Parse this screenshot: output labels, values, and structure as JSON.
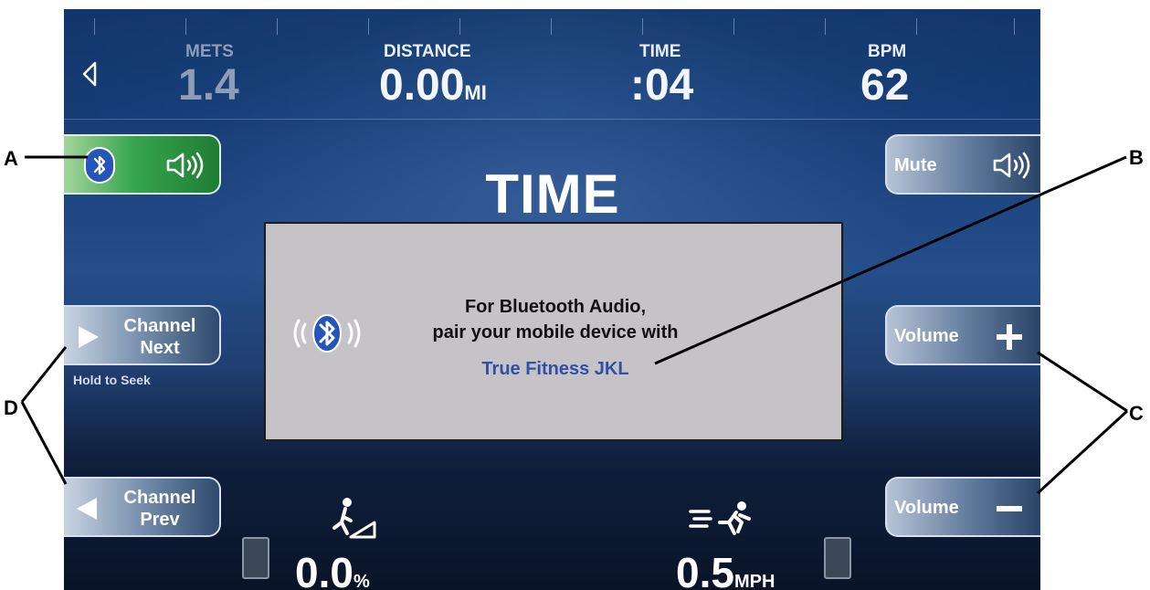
{
  "stats": {
    "mets": {
      "label": "METS",
      "value": "1.4"
    },
    "distance": {
      "label": "DISTANCE",
      "value": "0.00",
      "unit": "MI"
    },
    "time": {
      "label": "TIME",
      "value": ":04"
    },
    "bpm": {
      "label": "BPM",
      "value": "62"
    }
  },
  "metric_title": "TIME",
  "left_buttons": {
    "channel_next": {
      "line1": "Channel",
      "line2": "Next"
    },
    "hold_hint": "Hold to Seek",
    "channel_prev": {
      "line1": "Channel",
      "line2": "Prev"
    }
  },
  "right_buttons": {
    "mute": "Mute",
    "volume_up": "Volume",
    "volume_down": "Volume"
  },
  "dialog": {
    "line1": "For Bluetooth Audio,",
    "line2": "pair your mobile device with",
    "device_name": "True Fitness JKL"
  },
  "bottom": {
    "incline_value": "0.0",
    "incline_unit": "%",
    "speed_value": "0.5",
    "speed_unit": "MPH"
  },
  "callouts": {
    "a": "A",
    "b": "B",
    "c": "C",
    "d": "D"
  },
  "colors": {
    "active_button": "#36a54d",
    "dialog_background": "#c6c3c6",
    "device_name": "#2f4fa8",
    "screen_background": "#1a3f79"
  },
  "icons": [
    "back-arrow-icon",
    "bluetooth-icon",
    "speaker-icon",
    "play-icon",
    "plus-icon",
    "minus-icon",
    "incline-walker-icon",
    "runner-icon",
    "keypad-icon"
  ]
}
